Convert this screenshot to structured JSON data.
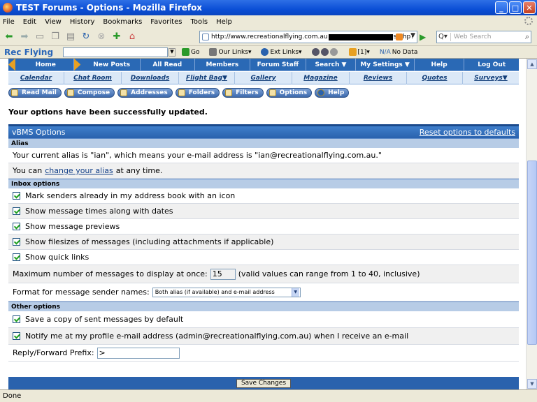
{
  "window": {
    "title": "TEST Forums - Options - Mozilla Firefox"
  },
  "menu": [
    "File",
    "Edit",
    "View",
    "History",
    "Bookmarks",
    "Favorites",
    "Tools",
    "Help"
  ],
  "navbar": {
    "url_start": "http://www.recreationalflying.com.au",
    "url_end": "s.php?",
    "search_placeholder": "Web Search"
  },
  "toolbar2": {
    "brand": "Rec Flying",
    "go": "Go",
    "our_links": "Our Links",
    "ext_links": "Ext Links",
    "counter": "[1]",
    "no_data": "No Data"
  },
  "forum_nav": [
    "Home",
    "New Posts",
    "All Read",
    "Members",
    "Forum Staff",
    "Search ▼",
    "My Settings ▼",
    "Help",
    "Log Out"
  ],
  "sub_nav": [
    "Calendar",
    "Chat Room",
    "Downloads",
    "Flight Bag▼",
    "Gallery",
    "Magazine",
    "Reviews",
    "Quotes",
    "Surveys▼"
  ],
  "pm_buttons": [
    "Read Mail",
    "Compose",
    "Addresses",
    "Folders",
    "Filters",
    "Options",
    "Help"
  ],
  "success_message": "Your options have been successfully updated.",
  "panel": {
    "title": "vBMS Options",
    "reset_link": "Reset options to defaults",
    "alias": {
      "heading": "Alias",
      "current": "Your current alias is \"ian\", which means your e-mail address is \"ian@recreationalflying.com.au.\"",
      "change_prefix": "You can",
      "change_link": "change your alias",
      "change_suffix": "at any time."
    },
    "inbox": {
      "heading": "Inbox options",
      "opt1": "Mark senders already in my address book with an icon",
      "opt2": "Show message times along with dates",
      "opt3": "Show message previews",
      "opt4": "Show filesizes of messages (including attachments if applicable)",
      "opt5": "Show quick links",
      "max_label": "Maximum number of messages to display at once:",
      "max_value": "15",
      "max_hint": "(valid values can range from 1 to 40, inclusive)",
      "format_label": "Format for message sender names:",
      "format_value": "Both alias (if available) and e-mail address"
    },
    "other": {
      "heading": "Other options",
      "opt1": "Save a copy of sent messages by default",
      "opt2": "Notify me at my profile e-mail address (admin@recreationalflying.com.au) when I receive an e-mail",
      "prefix_label": "Reply/Forward Prefix:",
      "prefix_value": ">"
    },
    "save_label": "Save Changes"
  },
  "status": "Done"
}
